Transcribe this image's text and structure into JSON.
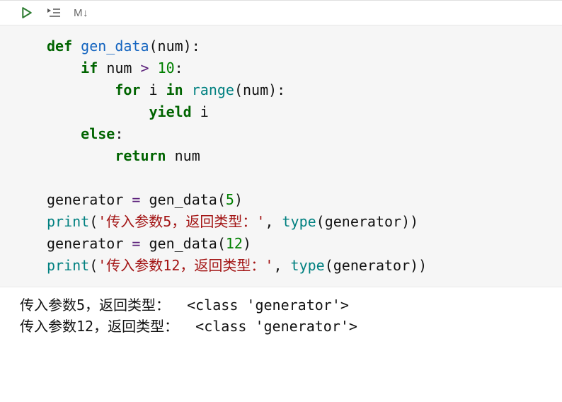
{
  "toolbar": {
    "run_icon": "run",
    "run_line_icon": "run-by-line",
    "md_label": "M↓"
  },
  "code": {
    "l1": {
      "kw_def": "def",
      "fn": "gen_data",
      "lp": "(",
      "arg": "num",
      "rp": ")",
      "colon": ":"
    },
    "l2": {
      "kw_if": "if",
      "var": "num",
      "op": ">",
      "num": "10",
      "colon": ":"
    },
    "l3": {
      "kw_for": "for",
      "var_i": "i",
      "kw_in": "in",
      "fn_range": "range",
      "lp": "(",
      "arg": "num",
      "rp": ")",
      "colon": ":"
    },
    "l4": {
      "kw_yield": "yield",
      "var": "i"
    },
    "l5": {
      "kw_else": "else",
      "colon": ":"
    },
    "l6": {
      "kw_return": "return",
      "var": "num"
    },
    "l8": {
      "lhs": "generator",
      "eq": "=",
      "fn": "gen_data",
      "lp": "(",
      "num": "5",
      "rp": ")"
    },
    "l9": {
      "fn_print": "print",
      "lp": "(",
      "str": "'传入参数5，返回类型：'",
      "comma": ",",
      "fn_type": "type",
      "lp2": "(",
      "arg": "generator",
      "rp2": ")",
      "rp": ")"
    },
    "l10": {
      "lhs": "generator",
      "eq": "=",
      "fn": "gen_data",
      "lp": "(",
      "num": "12",
      "rp": ")"
    },
    "l11": {
      "fn_print": "print",
      "lp": "(",
      "str": "'传入参数12，返回类型：'",
      "comma": ",",
      "fn_type": "type",
      "lp2": "(",
      "arg": "generator",
      "rp2": ")",
      "rp": ")"
    }
  },
  "output": {
    "line1": "传入参数5，返回类型：  <class 'generator'>",
    "line2": "传入参数12，返回类型：  <class 'generator'>"
  }
}
